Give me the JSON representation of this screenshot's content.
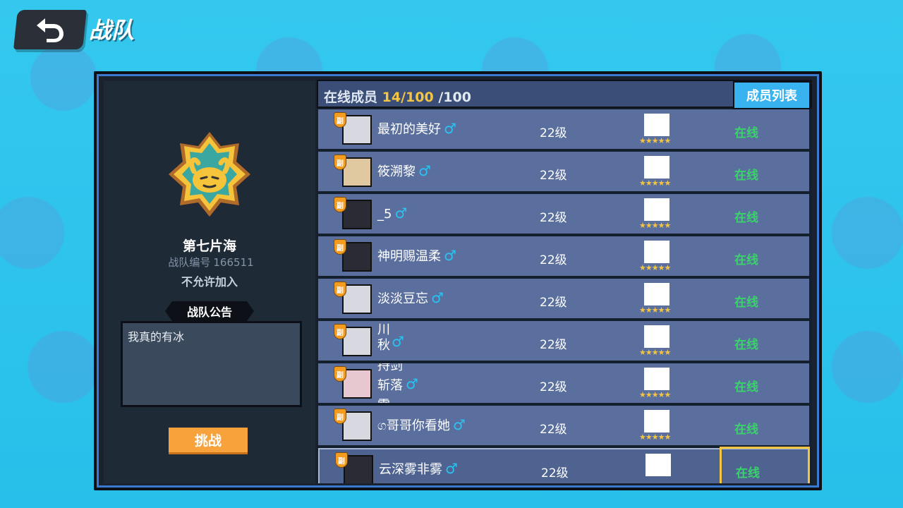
{
  "header": {
    "title": "战队"
  },
  "team": {
    "name": "第七片海",
    "id_label": "战队编号",
    "id_value": "166511",
    "join_status": "不允许加入",
    "notice_title": "战队公告",
    "notice_text": "我真的有冰",
    "challenge_label": "挑战"
  },
  "list": {
    "online_label": "在线成员",
    "online_current": "14/100",
    "online_total": "/100",
    "tab_label": "成员列表",
    "members": [
      {
        "name": "最初的美好",
        "gender": "♂",
        "level": "22级",
        "status": "在线",
        "rank": "副",
        "stars": "★★★★★"
      },
      {
        "name": "筱溯黎",
        "gender": "♂",
        "level": "22级",
        "status": "在线",
        "rank": "副",
        "stars": "★★★★★"
      },
      {
        "name": "_5",
        "gender": "♂",
        "level": "22级",
        "status": "在线",
        "rank": "副",
        "stars": "★★★★★"
      },
      {
        "name": "神明赐温柔",
        "gender": "♂",
        "level": "22级",
        "status": "在线",
        "rank": "副",
        "stars": "★★★★★"
      },
      {
        "name": "淡淡豆忘",
        "gender": "♂",
        "level": "22级",
        "status": "在线",
        "rank": "副",
        "stars": "★★★★★"
      },
      {
        "name": "川秋",
        "gender": "♂",
        "level": "22级",
        "status": "在线",
        "rank": "副",
        "stars": "★★★★★"
      },
      {
        "name": "持剑斩落雪",
        "gender": "♂",
        "level": "22级",
        "status": "在线",
        "rank": "副",
        "stars": "★★★★★"
      },
      {
        "name": "ග哥哥你看她",
        "gender": "♂",
        "level": "22级",
        "status": "在线",
        "rank": "副",
        "stars": "★★★★★"
      },
      {
        "name": "云深雾非雾",
        "gender": "♂",
        "level": "22级",
        "status": "在线",
        "rank": "副",
        "stars": "★★★★★"
      }
    ]
  }
}
